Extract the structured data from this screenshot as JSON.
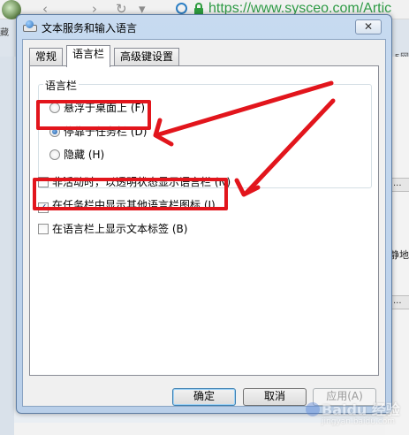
{
  "browser": {
    "url": "https://www.sysceo.com/Artic",
    "left_fragment": "藏",
    "right_fragment": "5网",
    "right_text": "静地",
    "right_btn_symbol": "..."
  },
  "dialog": {
    "title": "文本服务和输入语言",
    "close_symbol": "✕",
    "tabs": [
      {
        "label": "常规",
        "active": false
      },
      {
        "label": "语言栏",
        "active": true
      },
      {
        "label": "高级键设置",
        "active": false
      }
    ],
    "groupbox_title": "语言栏",
    "radios": [
      {
        "label": "悬浮于桌面上 (F)",
        "checked": false
      },
      {
        "label": "停靠于任务栏 (D)",
        "checked": true
      },
      {
        "label": "隐藏 (H)",
        "checked": false
      }
    ],
    "checkboxes": [
      {
        "label": "非活动时，以透明状态显示语言栏 (N)",
        "checked": false
      },
      {
        "label": "在任务栏中显示其他语言栏图标 (I)",
        "checked": true
      },
      {
        "label": "在语言栏上显示文本标签 (B)",
        "checked": false
      }
    ],
    "buttons": {
      "ok": "确定",
      "cancel": "取消",
      "apply": "应用(A)"
    }
  },
  "watermark": {
    "text": "Baidu 经验",
    "sub": "jingyan.baidu.com"
  }
}
